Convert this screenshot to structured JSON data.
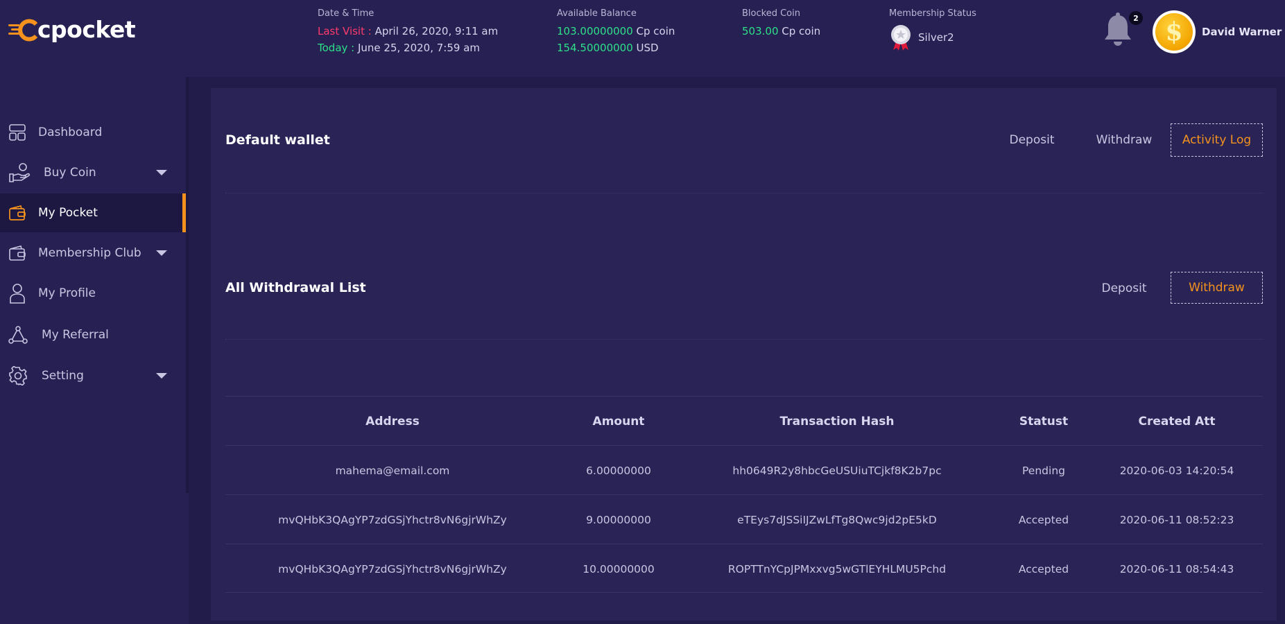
{
  "header": {
    "logo_text": "cpocket",
    "datetime": {
      "label": "Date & Time",
      "last_visit_label": "Last Visit :",
      "last_visit_value": "April 26, 2020, 9:11 am",
      "today_label": "Today :",
      "today_value": "June 25, 2020, 7:59 am"
    },
    "balance": {
      "label": "Available Balance",
      "coin_amount": "103.00000000",
      "coin_unit": "Cp coin",
      "usd_amount": "154.50000000",
      "usd_unit": "USD"
    },
    "blocked": {
      "label": "Blocked Coin",
      "amount": "503.00",
      "unit": "Cp coin"
    },
    "membership": {
      "label": "Membership Status",
      "value": "Silver2"
    },
    "notifications_count": "2",
    "avatar_symbol": "$",
    "username": "David Warner"
  },
  "sidebar": {
    "items": [
      {
        "label": "Dashboard",
        "icon": "dashboard-icon"
      },
      {
        "label": "Buy Coin",
        "icon": "buy-coin-icon"
      },
      {
        "label": "My Pocket",
        "icon": "wallet-icon"
      },
      {
        "label": "Membership Club",
        "icon": "membership-icon"
      },
      {
        "label": "My Profile",
        "icon": "user-icon"
      },
      {
        "label": "My Referral",
        "icon": "referral-icon"
      },
      {
        "label": "Setting",
        "icon": "gear-icon"
      }
    ],
    "active": "My Pocket"
  },
  "wallet_section": {
    "title": "Default wallet",
    "tabs": [
      "Deposit",
      "Withdraw",
      "Activity Log"
    ],
    "active_tab": "Activity Log"
  },
  "withdrawal_section": {
    "title": "All Withdrawal List",
    "tabs": [
      "Deposit",
      "Withdraw"
    ],
    "active_tab": "Withdraw"
  },
  "table": {
    "columns": [
      "Address",
      "Amount",
      "Transaction Hash",
      "Statust",
      "Created Att"
    ],
    "rows": [
      [
        "mahema@email.com",
        "6.00000000",
        "hh0649R2y8hbcGeUSUiuTCjkf8K2b7pc",
        "Pending",
        "2020-06-03 14:20:54"
      ],
      [
        "mvQHbK3QAgYP7zdGSjYhctr8vN6gjrWhZy",
        "9.00000000",
        "eTEys7dJSSiIJZwLfTg8Qwc9jd2pE5kD",
        "Accepted",
        "2020-06-11 08:52:23"
      ],
      [
        "mvQHbK3QAgYP7zdGSjYhctr8vN6gjrWhZy",
        "10.00000000",
        "ROPTTnYCpJPMxxvg5wGTlEYHLMU5Pchd",
        "Accepted",
        "2020-06-11 08:54:43"
      ]
    ]
  },
  "colors": {
    "background": "#262152",
    "card": "#2a2456",
    "accent": "#f5921e",
    "red": "#ff3b6b",
    "green": "#2ee08a"
  }
}
